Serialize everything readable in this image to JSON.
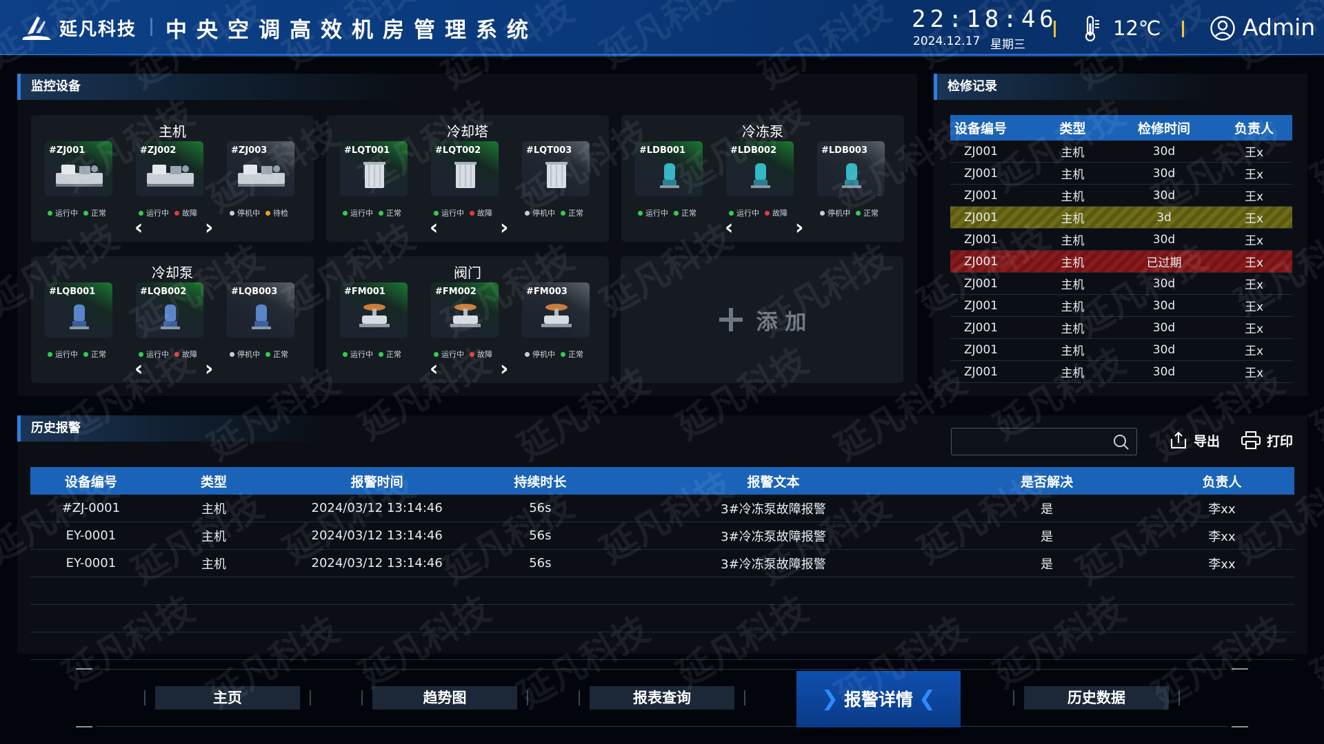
{
  "header": {
    "brand": "延凡科技",
    "title": "中央空调高效机房管理系统",
    "time": "22:18:46",
    "date": "2024.12.17",
    "weekday": "星期三",
    "temperature": "12℃",
    "user": "Admin"
  },
  "watermark": "延凡科技",
  "monitor": {
    "title": "监控设备",
    "add_label": "添 加",
    "groups": [
      {
        "name": "主机",
        "kind": "chiller",
        "devices": [
          {
            "id": "#ZJ001",
            "run": "运行中",
            "health": "正常",
            "glow": "green",
            "run_color": "#2ed14a",
            "health_color": "#2ed14a"
          },
          {
            "id": "#ZJ002",
            "run": "运行中",
            "health": "故障",
            "glow": "green",
            "run_color": "#2ed14a",
            "health_color": "#e23a3a"
          },
          {
            "id": "#ZJ003",
            "run": "停机中",
            "health": "待检",
            "glow": "grey",
            "run_color": "#c8ced6",
            "health_color": "#f0a020"
          }
        ]
      },
      {
        "name": "冷却塔",
        "kind": "tower",
        "devices": [
          {
            "id": "#LQT001",
            "run": "运行中",
            "health": "正常",
            "glow": "green",
            "run_color": "#2ed14a",
            "health_color": "#2ed14a"
          },
          {
            "id": "#LQT002",
            "run": "运行中",
            "health": "故障",
            "glow": "green",
            "run_color": "#2ed14a",
            "health_color": "#e23a3a"
          },
          {
            "id": "#LQT003",
            "run": "停机中",
            "health": "正常",
            "glow": "grey",
            "run_color": "#c8ced6",
            "health_color": "#2ed14a"
          }
        ]
      },
      {
        "name": "冷冻泵",
        "kind": "pump-teal",
        "devices": [
          {
            "id": "#LDB001",
            "run": "运行中",
            "health": "正常",
            "glow": "green",
            "run_color": "#2ed14a",
            "health_color": "#2ed14a"
          },
          {
            "id": "#LDB002",
            "run": "运行中",
            "health": "故障",
            "glow": "green",
            "run_color": "#2ed14a",
            "health_color": "#e23a3a"
          },
          {
            "id": "#LDB003",
            "run": "停机中",
            "health": "正常",
            "glow": "grey",
            "run_color": "#c8ced6",
            "health_color": "#2ed14a"
          }
        ]
      },
      {
        "name": "冷却泵",
        "kind": "pump-blue",
        "devices": [
          {
            "id": "#LQB001",
            "run": "运行中",
            "health": "正常",
            "glow": "green",
            "run_color": "#2ed14a",
            "health_color": "#2ed14a"
          },
          {
            "id": "#LQB002",
            "run": "运行中",
            "health": "故障",
            "glow": "green",
            "run_color": "#2ed14a",
            "health_color": "#e23a3a"
          },
          {
            "id": "#LQB003",
            "run": "停机中",
            "health": "正常",
            "glow": "grey",
            "run_color": "#c8ced6",
            "health_color": "#2ed14a"
          }
        ]
      },
      {
        "name": "阀门",
        "kind": "valve",
        "devices": [
          {
            "id": "#FM001",
            "run": "运行中",
            "health": "正常",
            "glow": "green",
            "run_color": "#2ed14a",
            "health_color": "#2ed14a"
          },
          {
            "id": "#FM002",
            "run": "运行中",
            "health": "故障",
            "glow": "green",
            "run_color": "#2ed14a",
            "health_color": "#e23a3a"
          },
          {
            "id": "#FM003",
            "run": "停机中",
            "health": "正常",
            "glow": "grey",
            "run_color": "#c8ced6",
            "health_color": "#2ed14a"
          }
        ]
      }
    ]
  },
  "maintenance": {
    "title": "检修记录",
    "columns": [
      "设备编号",
      "类型",
      "检修时间",
      "负责人"
    ],
    "rows": [
      {
        "cells": [
          "ZJ001",
          "主机",
          "30d",
          "王x"
        ],
        "state": "normal"
      },
      {
        "cells": [
          "ZJ001",
          "主机",
          "30d",
          "王x"
        ],
        "state": "normal"
      },
      {
        "cells": [
          "ZJ001",
          "主机",
          "30d",
          "王x"
        ],
        "state": "normal"
      },
      {
        "cells": [
          "ZJ001",
          "主机",
          "3d",
          "王x"
        ],
        "state": "warn"
      },
      {
        "cells": [
          "ZJ001",
          "主机",
          "30d",
          "王x"
        ],
        "state": "normal"
      },
      {
        "cells": [
          "ZJ001",
          "主机",
          "已过期",
          "王x"
        ],
        "state": "bad"
      },
      {
        "cells": [
          "ZJ001",
          "主机",
          "30d",
          "王x"
        ],
        "state": "normal"
      },
      {
        "cells": [
          "ZJ001",
          "主机",
          "30d",
          "王x"
        ],
        "state": "normal"
      },
      {
        "cells": [
          "ZJ001",
          "主机",
          "30d",
          "王x"
        ],
        "state": "normal"
      },
      {
        "cells": [
          "ZJ001",
          "主机",
          "30d",
          "王x"
        ],
        "state": "normal"
      },
      {
        "cells": [
          "ZJ001",
          "主机",
          "30d",
          "王x"
        ],
        "state": "normal"
      }
    ]
  },
  "alarms": {
    "title": "历史报警",
    "search_placeholder": "",
    "export_label": "导出",
    "print_label": "打印",
    "columns": [
      "设备编号",
      "类型",
      "报警时间",
      "持续时长",
      "报警文本",
      "是否解决",
      "负责人"
    ],
    "rows": [
      [
        "#ZJ-0001",
        "主机",
        "2024/03/12  13:14:46",
        "56s",
        "3#冷冻泵故障报警",
        "是",
        "李xx"
      ],
      [
        "EY-0001",
        "主机",
        "2024/03/12  13:14:46",
        "56s",
        "3#冷冻泵故障报警",
        "是",
        "李xx"
      ],
      [
        "EY-0001",
        "主机",
        "2024/03/12  13:14:46",
        "56s",
        "3#冷冻泵故障报警",
        "是",
        "李xx"
      ]
    ]
  },
  "nav": {
    "items": [
      "主页",
      "趋势图",
      "报表查询",
      "报警详情",
      "历史数据"
    ],
    "active": "报警详情"
  },
  "colors": {
    "accent": "#1a63b8",
    "warn": "#6e6c16",
    "bad": "#8a1a1c",
    "ok": "#2ed14a",
    "fault": "#e23a3a",
    "pending": "#f0a020"
  }
}
